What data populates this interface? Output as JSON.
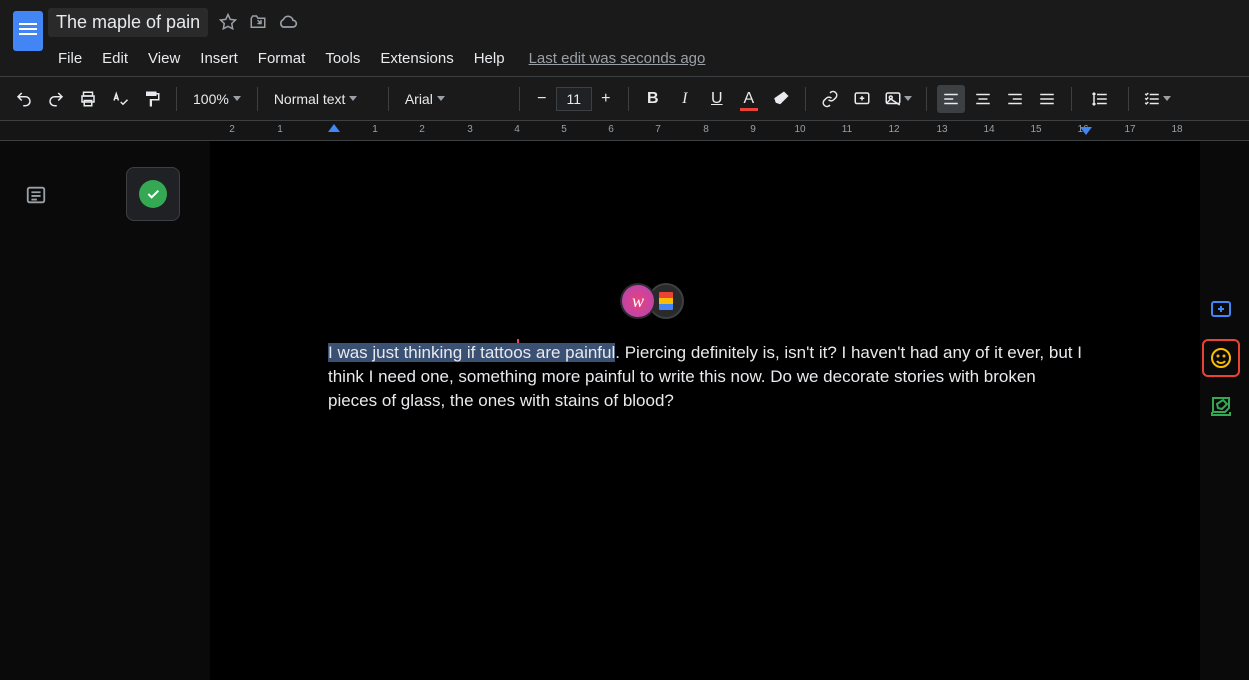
{
  "doc": {
    "title": "The maple of pain",
    "last_edit": "Last edit was seconds ago"
  },
  "menus": {
    "file": "File",
    "edit": "Edit",
    "view": "View",
    "insert": "Insert",
    "format": "Format",
    "tools": "Tools",
    "extensions": "Extensions",
    "help": "Help"
  },
  "toolbar": {
    "zoom": "100%",
    "style": "Normal text",
    "font": "Arial",
    "size": "11"
  },
  "ruler": {
    "numbers": [
      "2",
      "1",
      "",
      "1",
      "2",
      "3",
      "4",
      "5",
      "6",
      "7",
      "8",
      "9",
      "10",
      "11",
      "12",
      "13",
      "14",
      "15",
      "16",
      "17",
      "18"
    ]
  },
  "body": {
    "selected": "I was just thinking if tattoos are painful",
    "rest": ". Piercing definitely is, isn't it? I haven't had any of it ever, but I think I need one, something more painful to write this now. Do we decorate stories with broken pieces of glass, the ones with stains of blood?"
  },
  "presence": {
    "user1_initial": "w"
  }
}
